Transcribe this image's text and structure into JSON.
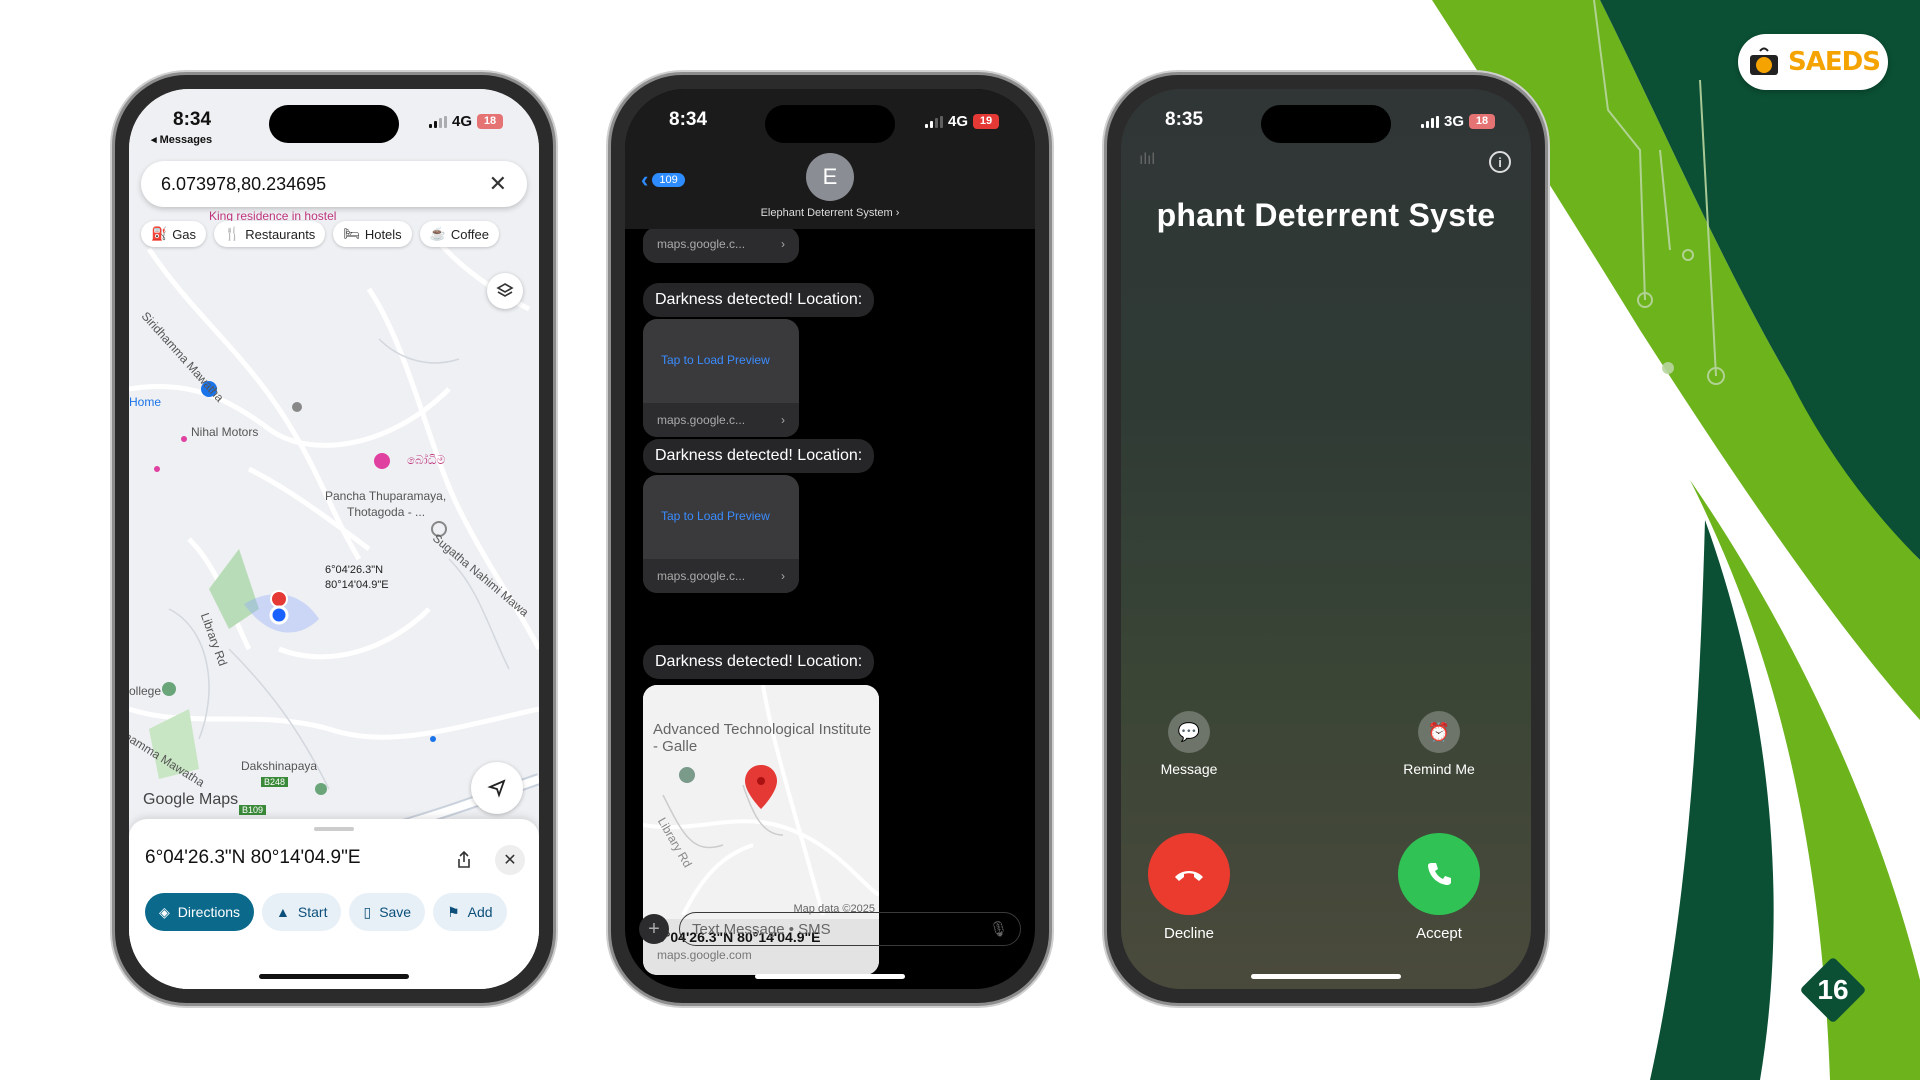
{
  "slide": {
    "logo_text": "SAEDS",
    "page_number": "16",
    "colors": {
      "dark_green": "#0b5034",
      "light_green": "#6cb31c"
    }
  },
  "phone1": {
    "time": "8:34",
    "back_label": "◂ Messages",
    "network": "4G",
    "battery": "18",
    "search_value": "6.073978,80.234695",
    "chips": [
      "Gas",
      "Restaurants",
      "Hotels",
      "Coffee"
    ],
    "map_labels": {
      "hostel": "King residence in hostel",
      "road1": "Siridhamma Mawatha",
      "home": "Home",
      "nihal": "Nihal Motors",
      "pancha": "Pancha Thuparamaya,",
      "thotagoda": "Thotagoda - ...",
      "sugatha": "Sugatha Nahimi Mawa",
      "sinhala": "බෝධිම",
      "library": "Library Rd",
      "college": "ollege",
      "road2": "hamma Mawatha",
      "dakshina": "Dakshinapaya",
      "b248": "B248",
      "b109": "B109",
      "pin_lat": "6°04'26.3\"N",
      "pin_lon": "80°14'04.9\"E"
    },
    "google_maps": "Google Maps",
    "sheet_coords": "6°04'26.3\"N 80°14'04.9\"E",
    "actions": [
      "Directions",
      "Start",
      "Save",
      "Add"
    ]
  },
  "phone2": {
    "time": "8:34",
    "network": "4G",
    "battery": "19",
    "back_count": "109",
    "avatar_letter": "E",
    "contact_name": "Elephant Deterrent System ›",
    "link_domain": "maps.google.c...",
    "tap_preview": "Tap to Load Preview",
    "message_text": "Darkness detected! Location:",
    "map_card_title": "Advanced Technological Institute - Galle",
    "map_card_road": "Library Rd",
    "map_data": "Map data ©2025",
    "map_card_coords": "6°04'26.3\"N 80°14'04.9\"E",
    "map_card_url": "maps.google.com",
    "compose_placeholder": "Text Message • SMS"
  },
  "phone3": {
    "time": "8:35",
    "network": "3G",
    "battery": "18",
    "caller_name": "phant Deterrent Syste",
    "message_label": "Message",
    "remind_label": "Remind Me",
    "decline_label": "Decline",
    "accept_label": "Accept",
    "colors": {
      "decline": "#eb3b2f",
      "accept": "#30c254"
    }
  }
}
